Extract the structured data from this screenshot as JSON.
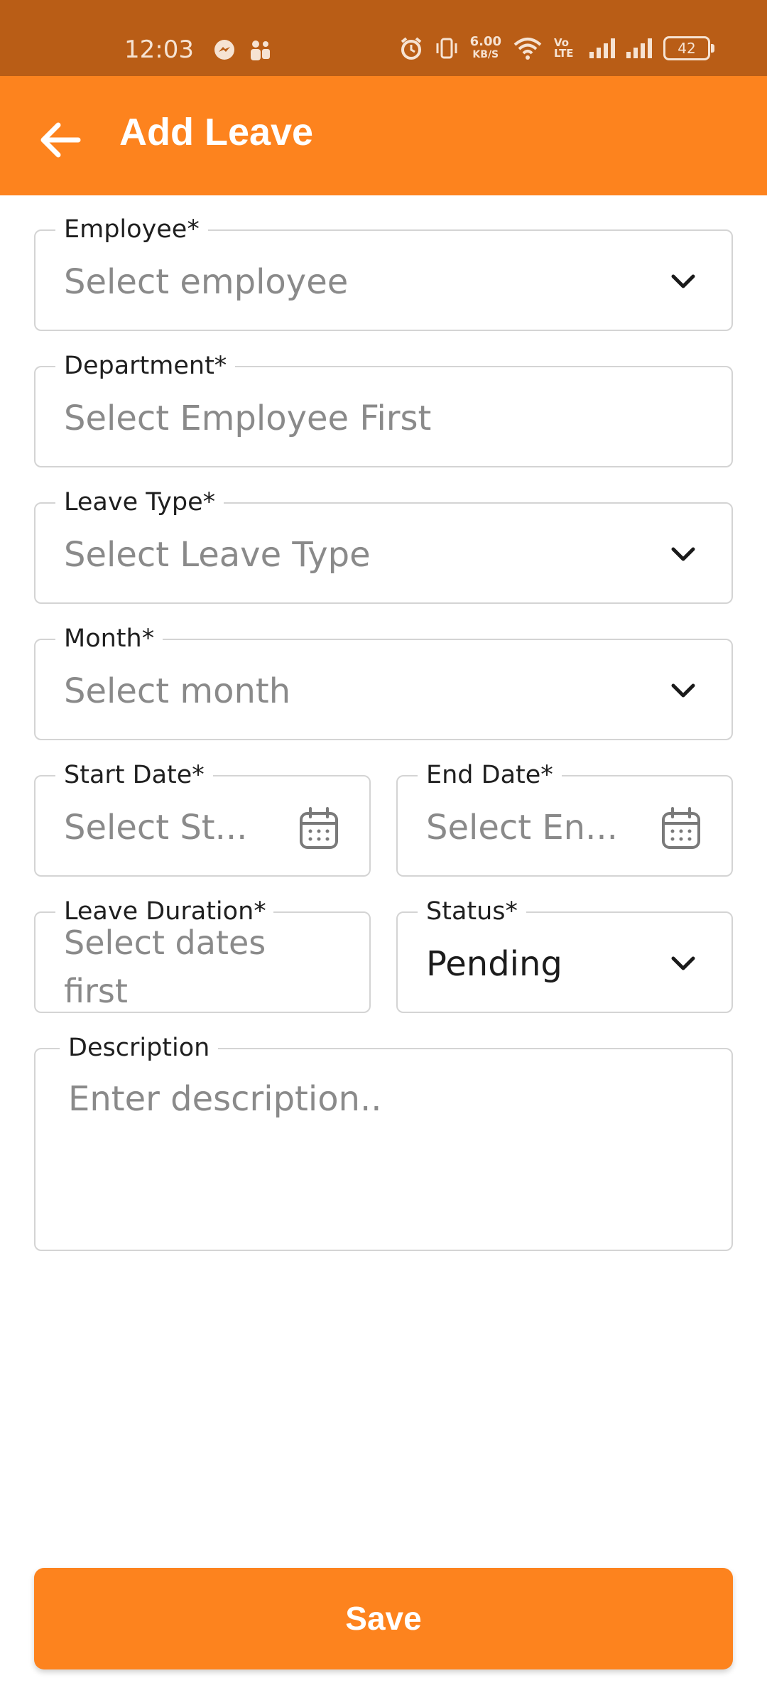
{
  "status_bar": {
    "time": "12:03",
    "speed_value": "6.00",
    "speed_unit": "KB/S",
    "network_label": "Vo LTE",
    "battery": "42"
  },
  "app_bar": {
    "title": "Add Leave",
    "back_icon": "arrow-left-icon"
  },
  "form": {
    "employee": {
      "label": "Employee*",
      "placeholder": "Select employee"
    },
    "department": {
      "label": "Department*",
      "placeholder": "Select Employee First"
    },
    "leave_type": {
      "label": "Leave Type*",
      "placeholder": "Select Leave Type"
    },
    "month": {
      "label": "Month*",
      "placeholder": "Select month"
    },
    "start_date": {
      "label": "Start Date*",
      "placeholder": "Select St..."
    },
    "end_date": {
      "label": "End Date*",
      "placeholder": "Select En..."
    },
    "leave_duration": {
      "label": "Leave Duration*",
      "placeholder": "Select dates first"
    },
    "status": {
      "label": "Status*",
      "value": "Pending"
    },
    "description": {
      "label": "Description",
      "placeholder": "Enter description.."
    }
  },
  "save_button": {
    "label": "Save"
  },
  "colors": {
    "status_bar": "#b95d16",
    "accent": "#fd831e",
    "border": "#d4d4d4",
    "placeholder": "#8a8a8a"
  }
}
